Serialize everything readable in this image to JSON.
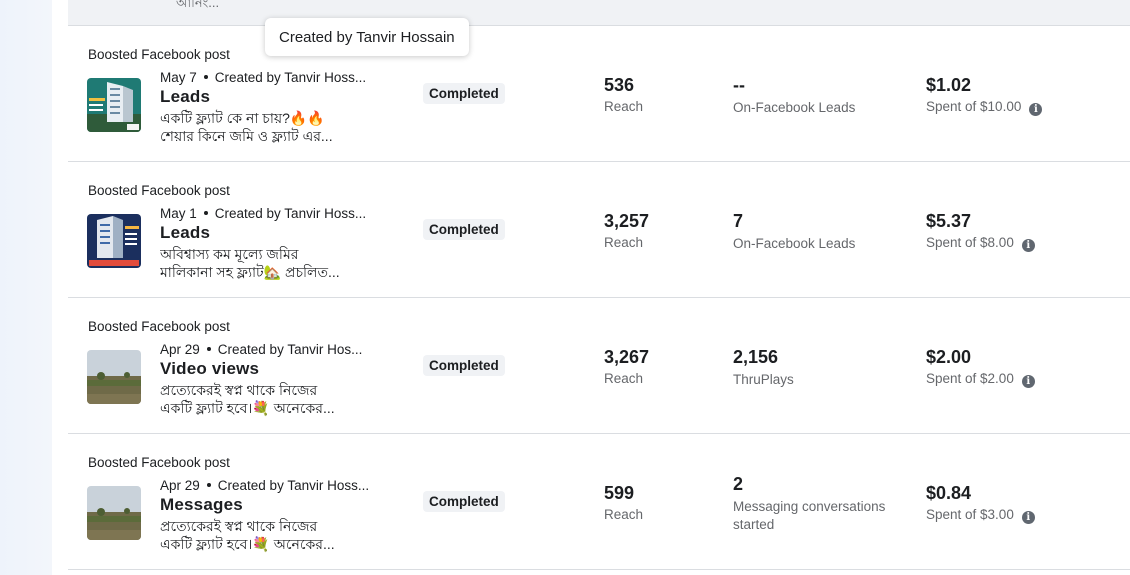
{
  "tooltip": {
    "text": "Created by Tanvir Hossain"
  },
  "top_strip": {
    "cut_text": "আর্নিং..."
  },
  "rows": [
    {
      "label": "Boosted Facebook post",
      "date": "May 7",
      "creator": "Created by Tanvir Hoss...",
      "objective": "Leads",
      "desc_line1": "একটি ফ্ল্যাট কে না চায়?🔥🔥",
      "desc_line2": "শেয়ার কিনে জমি ও ফ্ল্যাট এর...",
      "status": "Completed",
      "reach_value": "536",
      "reach_label": "Reach",
      "result_value": "--",
      "result_label": "On-Facebook Leads",
      "spent_value": "$1.02",
      "spent_label": "Spent of $10.00",
      "thumb_icon": "building-ad-thumbnail"
    },
    {
      "label": "Boosted Facebook post",
      "date": "May 1",
      "creator": "Created by Tanvir Hoss...",
      "objective": "Leads",
      "desc_line1": "অবিশ্বাস্য কম মূল্যে জমির",
      "desc_line2": "মালিকানা সহ ফ্ল্যাট🏡 প্রচলিত...",
      "status": "Completed",
      "reach_value": "3,257",
      "reach_label": "Reach",
      "result_value": "7",
      "result_label": "On-Facebook Leads",
      "spent_value": "$5.37",
      "spent_label": "Spent of $8.00",
      "thumb_icon": "building-ad-thumbnail"
    },
    {
      "label": "Boosted Facebook post",
      "date": "Apr 29",
      "creator": "Created by Tanvir Hos...",
      "objective": "Video views",
      "desc_line1": "প্রত্যেকেরই স্বপ্ন থাকে নিজের",
      "desc_line2": "একটি ফ্ল্যাট হবে।💐 অনেকের...",
      "status": "Completed",
      "reach_value": "3,267",
      "reach_label": "Reach",
      "result_value": "2,156",
      "result_label": "ThruPlays",
      "spent_value": "$2.00",
      "spent_label": "Spent of $2.00",
      "thumb_icon": "land-photo-thumbnail"
    },
    {
      "label": "Boosted Facebook post",
      "date": "Apr 29",
      "creator": "Created by Tanvir Hoss...",
      "objective": "Messages",
      "desc_line1": "প্রত্যেকেরই স্বপ্ন থাকে নিজের",
      "desc_line2": "একটি ফ্ল্যাট হবে।💐 অনেকের...",
      "status": "Completed",
      "reach_value": "599",
      "reach_label": "Reach",
      "result_value": "2",
      "result_label": "Messaging conversations started",
      "spent_value": "$0.84",
      "spent_label": "Spent of $3.00",
      "thumb_icon": "land-photo-thumbnail"
    }
  ],
  "colors": {
    "text": "#1c1e21",
    "muted": "#65676b",
    "badge_bg": "#f0f2f5",
    "divider": "#dadde1",
    "info_icon": "#606770"
  }
}
